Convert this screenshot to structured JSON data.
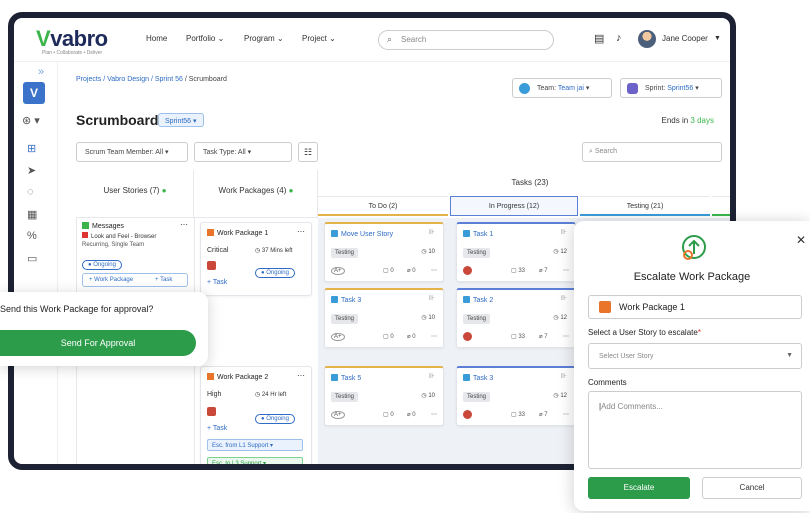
{
  "brand": {
    "logo": "vabro",
    "tagline": "Plan • Collaborate • Deliver"
  },
  "nav": {
    "items": [
      "Home",
      "Portfolio ⌄",
      "Program ⌄",
      "Project ⌄"
    ]
  },
  "search": {
    "placeholder": "Search"
  },
  "user": {
    "name": "Jane Cooper"
  },
  "breadcrumb": {
    "part1": "Projects / Vabro Design / Sprint 56",
    "part2": " / Scrumboard"
  },
  "team": {
    "label": "Team:",
    "value": "Team jai"
  },
  "sprint": {
    "label": "Sprint:",
    "value": "Sprint56"
  },
  "board": {
    "title": "Scrumboard",
    "sprint_badge": "Sprint56 ▾",
    "ends_prefix": "Ends in",
    "ends_value": "3 days"
  },
  "filters": {
    "member": "Scrum Team Member: All",
    "task_type": "Task Type: All",
    "search_placeholder": "Search"
  },
  "columns": {
    "stories": "User Stories (7)",
    "packages": "Work Packages (4)",
    "tasks": "Tasks (23)"
  },
  "statuses": [
    "To Do (2)",
    "In Progress (12)",
    "Testing (21)"
  ],
  "story": {
    "title": "Messages",
    "sub1": "Look and Feel - Browser",
    "sub2": "Recurring, Single Team",
    "status": "Ongoing",
    "add_wp": "+ Work Package",
    "add_task": "+ Task"
  },
  "wp1": {
    "title": "Work Package  1",
    "priority": "Critical",
    "time": "37 Mins left",
    "status": "Ongoing",
    "add_task": "+ Task"
  },
  "wp2": {
    "title": "Work Package  2",
    "priority": "High",
    "time": "24 Hr left",
    "status": "Ongoing",
    "add_task": "+ Task",
    "esc_from": "Esc. from  L1 Support ▾",
    "esc_to": "Esc. to  L3 Support ▾"
  },
  "tasks": [
    {
      "title": "Move User Story",
      "tag": "Testing",
      "count": "10",
      "c1": "0",
      "c2": "0"
    },
    {
      "title": "Task 1",
      "tag": "Testing",
      "count": "12",
      "c1": "33",
      "c2": "7"
    },
    {
      "title": "Task 3",
      "tag": "Testing",
      "count": "10",
      "c1": "0",
      "c2": "0"
    },
    {
      "title": "Task 2",
      "tag": "Testing",
      "count": "12",
      "c1": "33",
      "c2": "7"
    },
    {
      "title": "Task 5",
      "tag": "Testing",
      "count": "10",
      "c1": "0",
      "c2": "0"
    },
    {
      "title": "Task 3",
      "tag": "Testing",
      "count": "12",
      "c1": "33",
      "c2": "7"
    }
  ],
  "approval": {
    "question": "Send this Work Package for approval?",
    "button": "Send For Approval"
  },
  "modal": {
    "title": "Escalate Work Package",
    "wp": "Work Package  1",
    "story_label": "Select a User Story to escalate",
    "story_placeholder": "Select User Story",
    "comments_label": "Comments",
    "comments_placeholder": "Add Comments...",
    "escalate": "Escalate",
    "cancel": "Cancel"
  }
}
